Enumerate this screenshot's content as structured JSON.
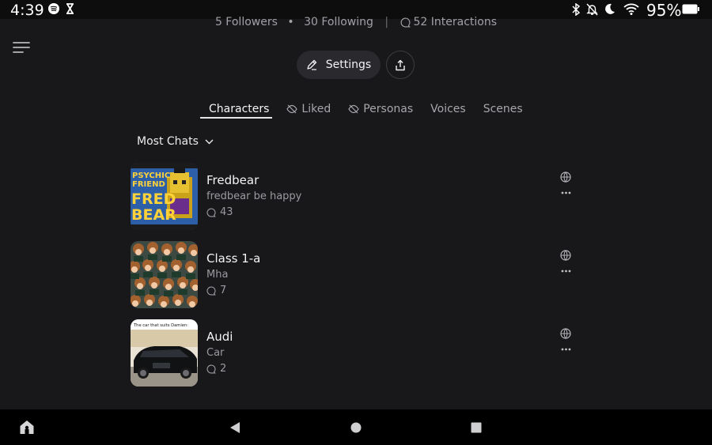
{
  "status_bar": {
    "time": "4:39",
    "battery": "95%",
    "icons": [
      "spotify-icon",
      "hourglass-icon",
      "bluetooth-icon",
      "notifications-off-icon",
      "moon-icon",
      "wifi-icon",
      "battery-icon"
    ]
  },
  "profile": {
    "followers": "5 Followers",
    "following": "30 Following",
    "interactions": "52 Interactions"
  },
  "actions": {
    "settings_label": "Settings"
  },
  "tabs": [
    {
      "label": "Characters",
      "active": true
    },
    {
      "label": "Liked",
      "icon": "eye-off-icon"
    },
    {
      "label": "Personas",
      "icon": "eye-off-icon"
    },
    {
      "label": "Voices"
    },
    {
      "label": "Scenes"
    }
  ],
  "sort": {
    "label": "Most Chats"
  },
  "characters": [
    {
      "name": "Fredbear",
      "description": "fredbear be happy",
      "chats": "43",
      "thumb_text": "PSYCHIC FRIEND FRED BEAR"
    },
    {
      "name": "Class 1-a",
      "description": "Mha",
      "chats": "7"
    },
    {
      "name": "Audi",
      "description": "Car",
      "chats": "2",
      "thumb_text": "The car that suits Damien:"
    }
  ],
  "colors": {
    "background": "#18181b",
    "button_bg": "#2a2a2e",
    "muted_text": "#9a9aa0"
  }
}
